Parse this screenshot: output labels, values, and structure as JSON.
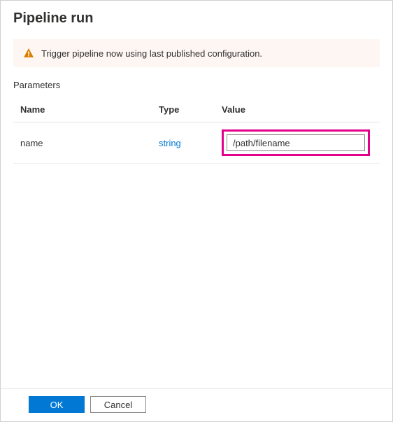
{
  "header": {
    "title": "Pipeline run"
  },
  "banner": {
    "icon": "warning-icon",
    "text": "Trigger pipeline now using last published configuration."
  },
  "parameters": {
    "section_label": "Parameters",
    "columns": {
      "name": "Name",
      "type": "Type",
      "value": "Value"
    },
    "rows": [
      {
        "name": "name",
        "type": "string",
        "value": "/path/filename"
      }
    ]
  },
  "footer": {
    "ok_label": "OK",
    "cancel_label": "Cancel"
  }
}
